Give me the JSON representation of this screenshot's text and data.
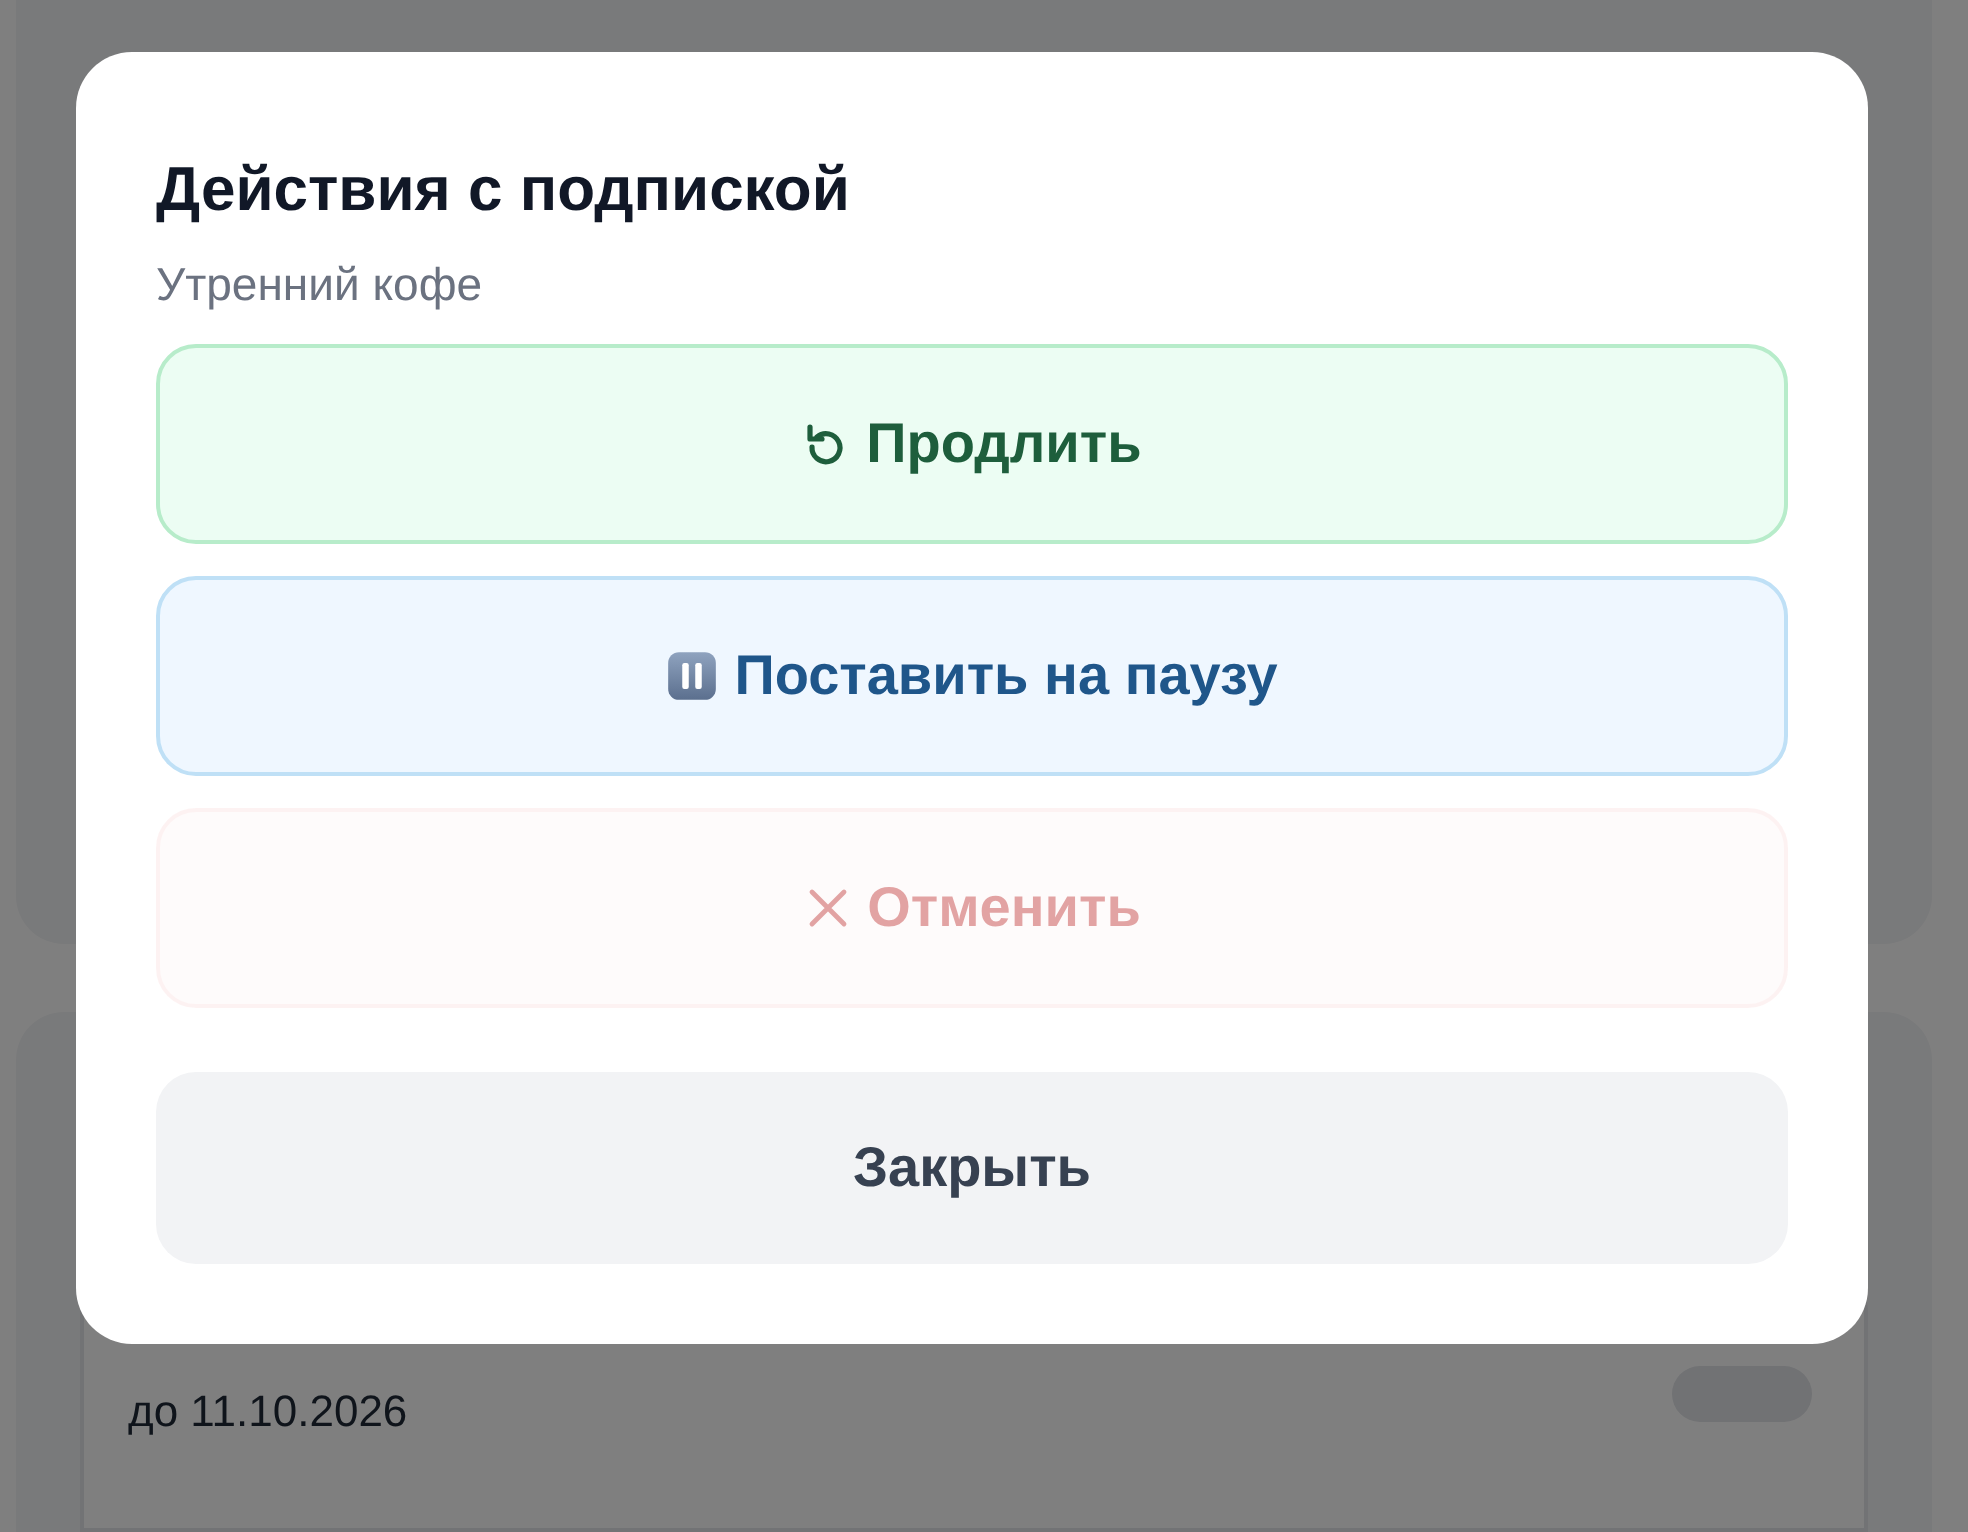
{
  "page": {
    "cards": [
      {
        "expiry": "до 11.10.2026"
      }
    ]
  },
  "dialog": {
    "title": "Действия с подпиской",
    "subtitle": "Утренний кофе",
    "actions": [
      {
        "kind": "renew",
        "label": "Продлить",
        "disabled": false
      },
      {
        "kind": "pause",
        "label": "Поставить на паузу",
        "disabled": false
      },
      {
        "kind": "cancel",
        "label": "Отменить",
        "disabled": true
      }
    ],
    "close": {
      "label": "Закрыть"
    }
  }
}
